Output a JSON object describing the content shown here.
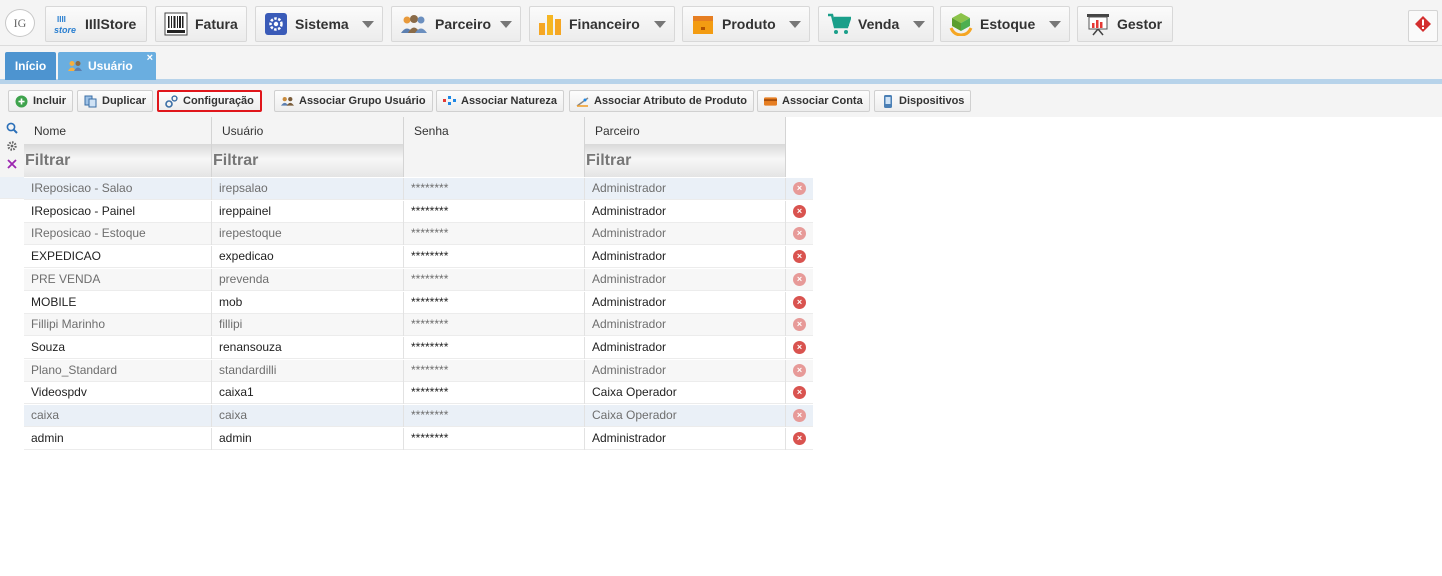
{
  "logo": {
    "text": "IG"
  },
  "menu": [
    {
      "label": "IIllStore",
      "icon": "store-icon",
      "has_caret": false
    },
    {
      "label": "Fatura",
      "icon": "barcode-icon",
      "has_caret": false
    },
    {
      "label": "Sistema",
      "icon": "gear-icon",
      "has_caret": true
    },
    {
      "label": "Parceiro",
      "icon": "people-icon",
      "has_caret": true
    },
    {
      "label": "Financeiro",
      "icon": "bar-chart-icon",
      "has_caret": true
    },
    {
      "label": "Produto",
      "icon": "box-icon",
      "has_caret": true
    },
    {
      "label": "Venda",
      "icon": "cart-icon",
      "has_caret": true
    },
    {
      "label": "Estoque",
      "icon": "stock-cube-icon",
      "has_caret": true
    },
    {
      "label": "Gestor",
      "icon": "presentation-icon",
      "has_caret": false
    }
  ],
  "tabs": [
    {
      "label": "Início",
      "active": false
    },
    {
      "label": "Usuário",
      "active": true,
      "close": "×"
    }
  ],
  "toolbar": [
    {
      "label": "Incluir",
      "icon": "plus-circle-icon"
    },
    {
      "label": "Duplicar",
      "icon": "duplicate-icon"
    },
    {
      "label": "Configuração",
      "icon": "config-icon",
      "highlighted": true
    },
    {
      "label": "Associar Grupo Usuário",
      "icon": "group-icon"
    },
    {
      "label": "Associar Natureza",
      "icon": "nature-icon"
    },
    {
      "label": "Associar Atributo de Produto",
      "icon": "attribute-icon"
    },
    {
      "label": "Associar Conta",
      "icon": "account-icon"
    },
    {
      "label": "Dispositivos",
      "icon": "device-icon"
    }
  ],
  "grid": {
    "columns": [
      "Nome",
      "Usuário",
      "Senha",
      "Parceiro"
    ],
    "filter_placeholder": "Filtrar",
    "rows": [
      {
        "nome": "IReposicao - Salao",
        "usuario": "irepsalao",
        "senha": "********",
        "parceiro": "Administrador",
        "muted": true
      },
      {
        "nome": "IReposicao - Painel",
        "usuario": "ireppainel",
        "senha": "********",
        "parceiro": "Administrador",
        "muted": false
      },
      {
        "nome": "IReposicao - Estoque",
        "usuario": "irepestoque",
        "senha": "********",
        "parceiro": "Administrador",
        "muted": true
      },
      {
        "nome": "EXPEDICAO",
        "usuario": "expedicao",
        "senha": "********",
        "parceiro": "Administrador",
        "muted": false
      },
      {
        "nome": "PRE VENDA",
        "usuario": "prevenda",
        "senha": "********",
        "parceiro": "Administrador",
        "muted": true
      },
      {
        "nome": "MOBILE",
        "usuario": "mob",
        "senha": "********",
        "parceiro": "Administrador",
        "muted": false
      },
      {
        "nome": "Fillipi Marinho",
        "usuario": "fillipi",
        "senha": "********",
        "parceiro": "Administrador",
        "muted": true
      },
      {
        "nome": "Souza",
        "usuario": "renansouza",
        "senha": "********",
        "parceiro": "Administrador",
        "muted": false
      },
      {
        "nome": "Plano_Standard",
        "usuario": "standardilli",
        "senha": "********",
        "parceiro": "Administrador",
        "muted": true
      },
      {
        "nome": "Videospdv",
        "usuario": "caixa1",
        "senha": "********",
        "parceiro": "Caixa Operador",
        "muted": false
      },
      {
        "nome": "caixa",
        "usuario": "caixa",
        "senha": "********",
        "parceiro": "Caixa Operador",
        "muted": true
      },
      {
        "nome": "admin",
        "usuario": "admin",
        "senha": "********",
        "parceiro": "Administrador",
        "muted": false
      }
    ],
    "delete_glyph": "×"
  },
  "colors": {
    "tab_active": "#6aaee0",
    "tab_inicio": "#4d94d0",
    "highlight_border": "#e0161b",
    "delete": "#d9534f"
  }
}
